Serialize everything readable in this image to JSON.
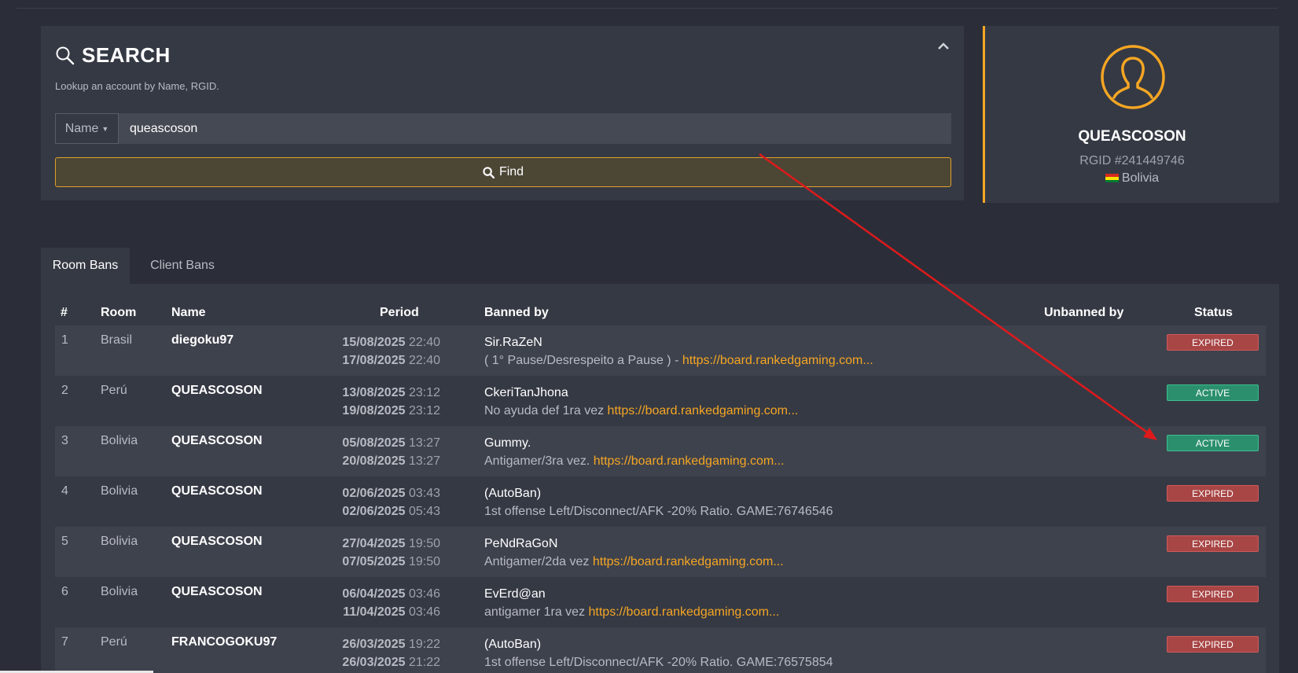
{
  "search": {
    "title": "SEARCH",
    "subtitle": "Lookup an account by Name, RGID.",
    "field_type": "Name",
    "value": "queascoson",
    "find_label": "Find"
  },
  "profile": {
    "name": "QUEASCOSON",
    "rgid": "RGID #241449746",
    "country": "Bolivia"
  },
  "tabs": [
    "Room Bans",
    "Client Bans"
  ],
  "table": {
    "headers": [
      "#",
      "Room",
      "Name",
      "Period",
      "Banned by",
      "Unbanned by",
      "Status"
    ],
    "rows": [
      {
        "num": "1",
        "room": "Brasil",
        "name": "diegoku97",
        "start_date": "15/08/2025",
        "start_time": "22:40",
        "end_date": "17/08/2025",
        "end_time": "22:40",
        "by": "Sir.RaZeN",
        "reason": "( 1° Pause/Desrespeito a Pause ) - ",
        "link": "https://board.rankedgaming.com...",
        "status": "EXPIRED"
      },
      {
        "num": "2",
        "room": "Perú",
        "name": "QUEASCOSON",
        "start_date": "13/08/2025",
        "start_time": "23:12",
        "end_date": "19/08/2025",
        "end_time": "23:12",
        "by": "CkeriTanJhona",
        "reason": "No ayuda def 1ra vez ",
        "link": "https://board.rankedgaming.com...",
        "status": "ACTIVE"
      },
      {
        "num": "3",
        "room": "Bolivia",
        "name": "QUEASCOSON",
        "start_date": "05/08/2025",
        "start_time": "13:27",
        "end_date": "20/08/2025",
        "end_time": "13:27",
        "by": "Gummy.",
        "reason": "Antigamer/3ra vez. ",
        "link": "https://board.rankedgaming.com...",
        "status": "ACTIVE"
      },
      {
        "num": "4",
        "room": "Bolivia",
        "name": "QUEASCOSON",
        "start_date": "02/06/2025",
        "start_time": "03:43",
        "end_date": "02/06/2025",
        "end_time": "05:43",
        "by": "(AutoBan)",
        "reason": "1st offense Left/Disconnect/AFK -20% Ratio. GAME:76746546",
        "link": "",
        "status": "EXPIRED"
      },
      {
        "num": "5",
        "room": "Bolivia",
        "name": "QUEASCOSON",
        "start_date": "27/04/2025",
        "start_time": "19:50",
        "end_date": "07/05/2025",
        "end_time": "19:50",
        "by": "PeNdRaGoN",
        "reason": "Antigamer/2da vez ",
        "link": "https://board.rankedgaming.com...",
        "status": "EXPIRED"
      },
      {
        "num": "6",
        "room": "Bolivia",
        "name": "QUEASCOSON",
        "start_date": "06/04/2025",
        "start_time": "03:46",
        "end_date": "11/04/2025",
        "end_time": "03:46",
        "by": "EvErd@an",
        "reason": "antigamer 1ra vez ",
        "link": "https://board.rankedgaming.com...",
        "status": "EXPIRED"
      },
      {
        "num": "7",
        "room": "Perú",
        "name": "FRANCOGOKU97",
        "start_date": "26/03/2025",
        "start_time": "19:22",
        "end_date": "26/03/2025",
        "end_time": "21:22",
        "by": "(AutoBan)",
        "reason": "1st offense Left/Disconnect/AFK -20% Ratio. GAME:76575854",
        "link": "",
        "status": "EXPIRED"
      }
    ]
  },
  "colors": {
    "accent": "#f5a623",
    "expired": "#a84545",
    "active": "#2b8f6d",
    "annotation_arrow": "#e0191b"
  },
  "icons": {
    "search": "search-icon",
    "collapse": "chevron-up-icon",
    "avatar": "user-avatar-icon"
  }
}
